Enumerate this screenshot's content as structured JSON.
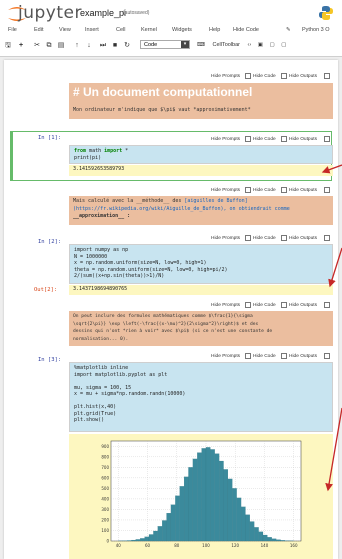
{
  "header": {
    "logo_text": "jupyter",
    "notebook_name": "example_pi",
    "autosave": "(autosaved)",
    "kernel_label": "Python 3 O",
    "edit_icon": "pencil-icon"
  },
  "menu": [
    "File",
    "Edit",
    "View",
    "Insert",
    "Cell",
    "Kernel",
    "Widgets",
    "Help",
    "Hide Code"
  ],
  "toolbar": {
    "cell_type": "Code",
    "celltoolbar_label": "CellToolbar",
    "buttons": [
      "save-icon",
      "plus-icon",
      "cut-icon",
      "copy-icon",
      "paste-icon",
      "up-icon",
      "down-icon",
      "skip-icon",
      "stop-icon",
      "restart-icon"
    ]
  },
  "celltoolbar": {
    "hide_prompts": "Hide Prompts",
    "hide_code": "Hide Code",
    "hide_outputs": "Hide Outputs"
  },
  "cells": {
    "md1": {
      "title": "# Un document computationnel",
      "text": "Mon ordinateur m'indique que $\\pi$ vaut *approximativement*"
    },
    "code1": {
      "prompt": "In [1]:",
      "line1_kw1": "from",
      "line1_mod": " math ",
      "line1_kw2": "import",
      "line1_rest": " *",
      "line2": "print(pi)",
      "output": "3.141592653589793"
    },
    "md2": {
      "line1_a": "Mais calculé avec la __méthode__ des ",
      "line1_link": "[aiguilles de Buffon]",
      "line2": "(https://fr.wikipedia.org/wiki/Aiguille_de_Buffon), on obtiendrait comme",
      "line3": "__approximation__ :"
    },
    "code2": {
      "prompt": "In [2]:",
      "lines": [
        "import numpy as np",
        "N = 1000000",
        "x = np.random.uniform(size=N, low=0, high=1)",
        "theta = np.random.uniform(size=N, low=0, high=pi/2)",
        "2/(sum((x+np.sin(theta))>1)/N)"
      ],
      "out_prompt": "Out[2]:",
      "output": "3.1437198694890765"
    },
    "md3": {
      "lines": [
        "On peut inclure des formules mathématiques comme $\\frac{1}{\\sigma",
        "\\sqrt{2\\pi}} \\exp \\left(-\\frac{(x-\\mu)^2}{2\\sigma^2}\\right)$ et des",
        "dessins qui n'ont *rien à voir* avec $\\pi$ (si ce n'est une constante de",
        "normalisation... 0)."
      ]
    },
    "code3": {
      "prompt": "In [3]:",
      "lines": [
        "%matplotlib inline",
        "import matplotlib.pyplot as plt",
        "",
        "mu, sigma = 100, 15",
        "x = mu + sigma*np.random.randn(10000)",
        "",
        "plt.hist(x,40)",
        "plt.grid(True)",
        "plt.show()"
      ]
    }
  },
  "chart_data": {
    "type": "bar",
    "title": "",
    "xlabel": "",
    "ylabel": "",
    "xticks": [
      "40",
      "60",
      "80",
      "100",
      "120",
      "140",
      "160"
    ],
    "yticks": [
      "0",
      "100",
      "200",
      "300",
      "400",
      "500",
      "600",
      "700",
      "800",
      "900"
    ],
    "xlim": [
      35,
      165
    ],
    "ylim": [
      0,
      950
    ],
    "grid": true,
    "bar_color": "#3b8a9c",
    "bins_start": 40,
    "bin_width": 3,
    "values": [
      2,
      3,
      5,
      9,
      15,
      25,
      40,
      62,
      95,
      140,
      195,
      265,
      345,
      430,
      520,
      610,
      700,
      780,
      840,
      880,
      890,
      870,
      830,
      760,
      680,
      590,
      500,
      410,
      325,
      250,
      185,
      130,
      88,
      57,
      36,
      22,
      13,
      7,
      4,
      2
    ]
  }
}
